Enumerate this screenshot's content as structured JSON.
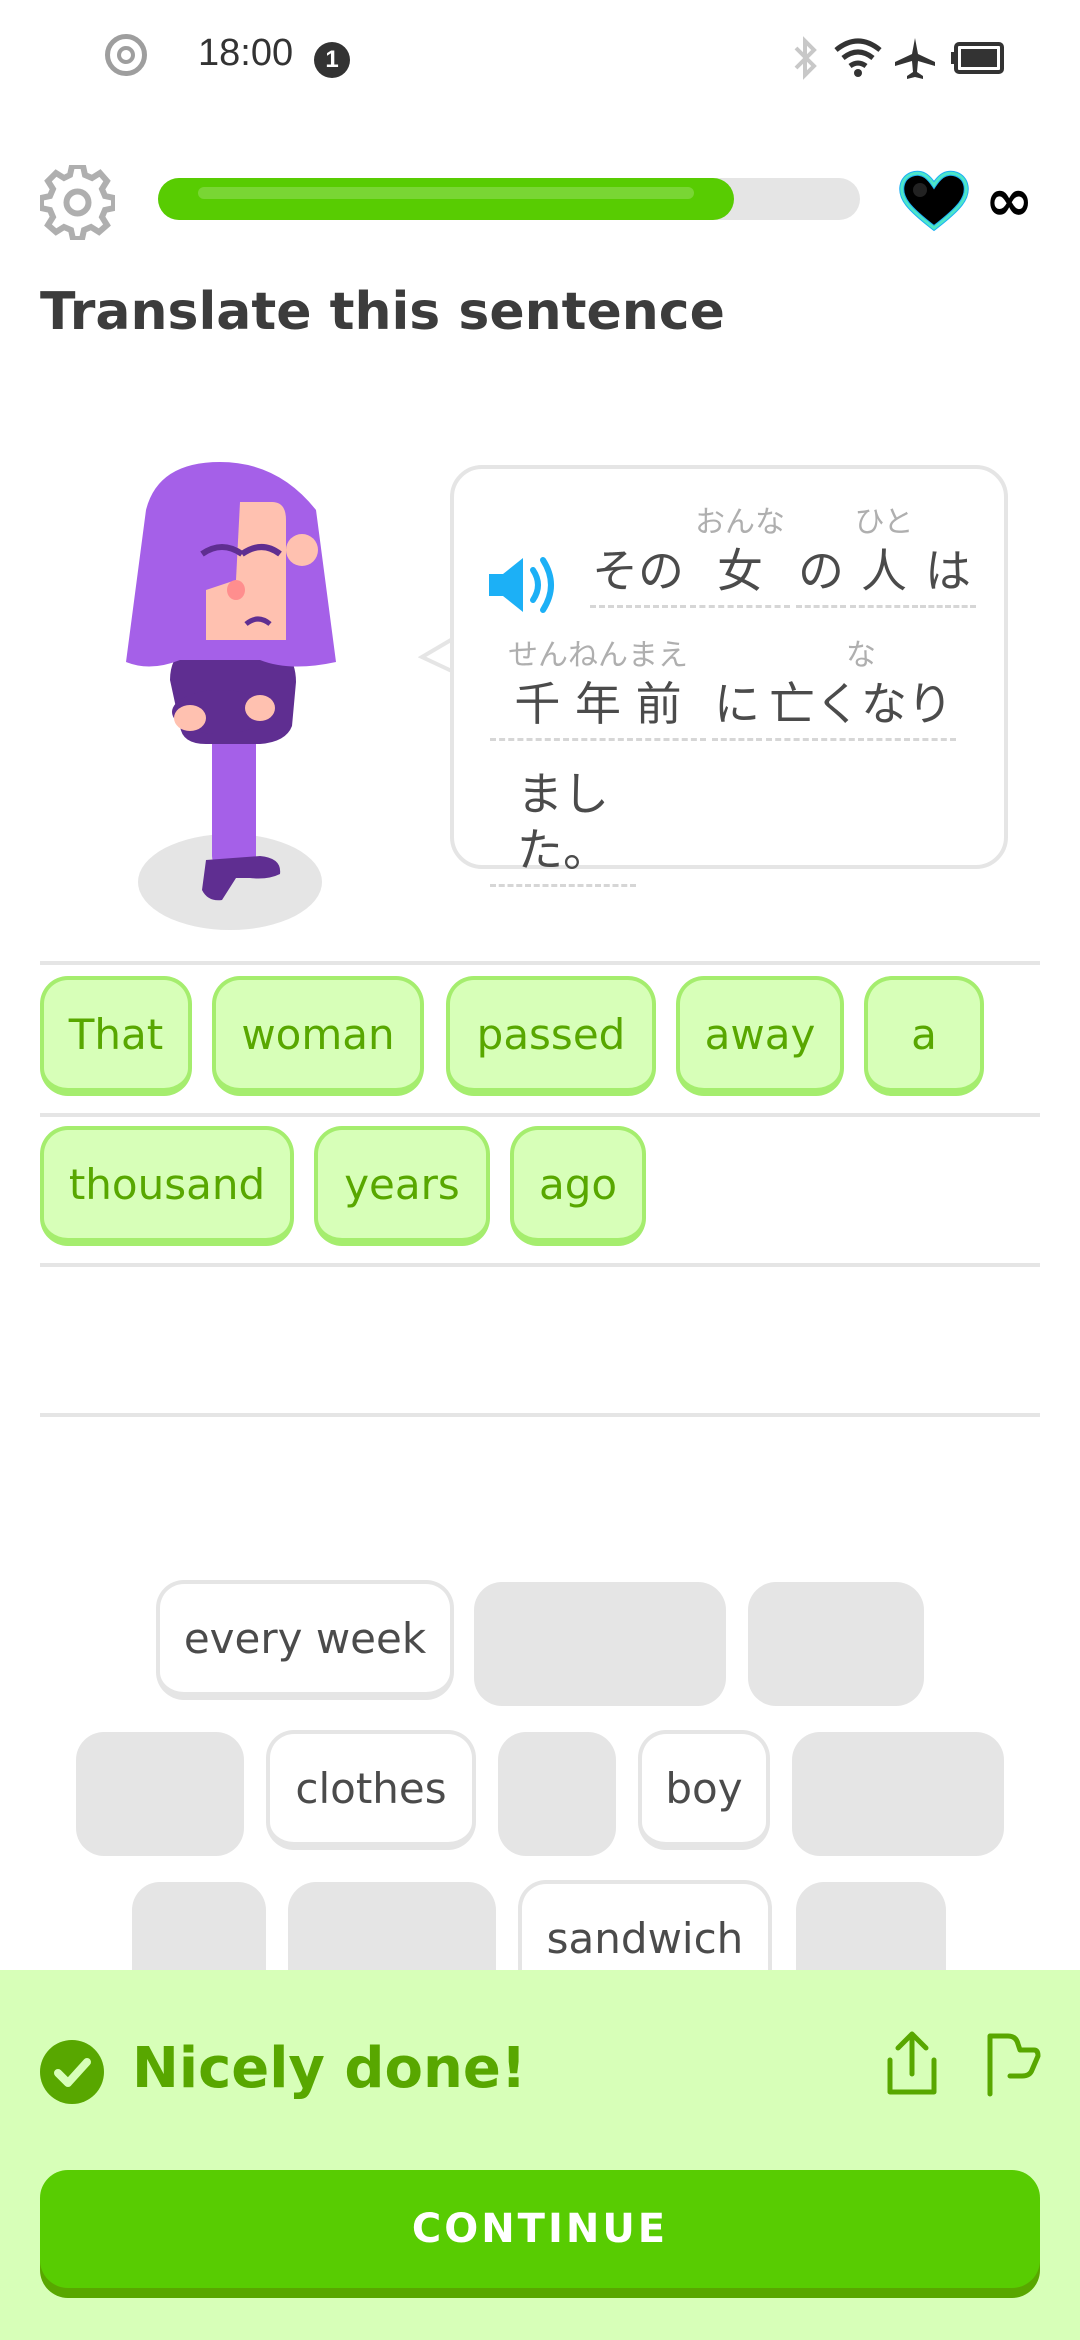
{
  "status_bar": {
    "time": "18:00",
    "notification_count": "1",
    "icons": [
      "record-icon",
      "bluetooth-icon",
      "wifi-icon",
      "airplane-icon",
      "battery-icon"
    ]
  },
  "header": {
    "settings_icon": "gear-icon",
    "progress": 0.82,
    "hearts_icon": "heart-icon",
    "hearts_value": "∞"
  },
  "title": "Translate this sentence",
  "prompt": {
    "speaker_icon": "speaker-icon",
    "tokens": [
      {
        "furigana": "",
        "text": "その"
      },
      {
        "furigana": "おんな",
        "text": "女"
      },
      {
        "furigana": "",
        "text": "の"
      },
      {
        "furigana": "ひと",
        "text": "人"
      },
      {
        "furigana": "",
        "text": "は"
      },
      {
        "furigana": "せんねんまえ",
        "text": "千 年 前"
      },
      {
        "furigana": "",
        "text": "に"
      },
      {
        "furigana": "な",
        "text": "亡くなり"
      },
      {
        "furigana": "",
        "text": "ました。"
      }
    ]
  },
  "answer": {
    "words": [
      "That",
      "woman",
      "passed",
      "away",
      "a",
      "thousand",
      "years",
      "ago"
    ]
  },
  "word_bank": {
    "visible_words": [
      "every week",
      "clothes",
      "boy",
      "sandwich"
    ]
  },
  "feedback": {
    "message": "Nicely done!",
    "continue_label": "CONTINUE",
    "colors": {
      "success": "#58cc02",
      "success_text": "#58a700",
      "panel": "#d7ffb8"
    }
  }
}
